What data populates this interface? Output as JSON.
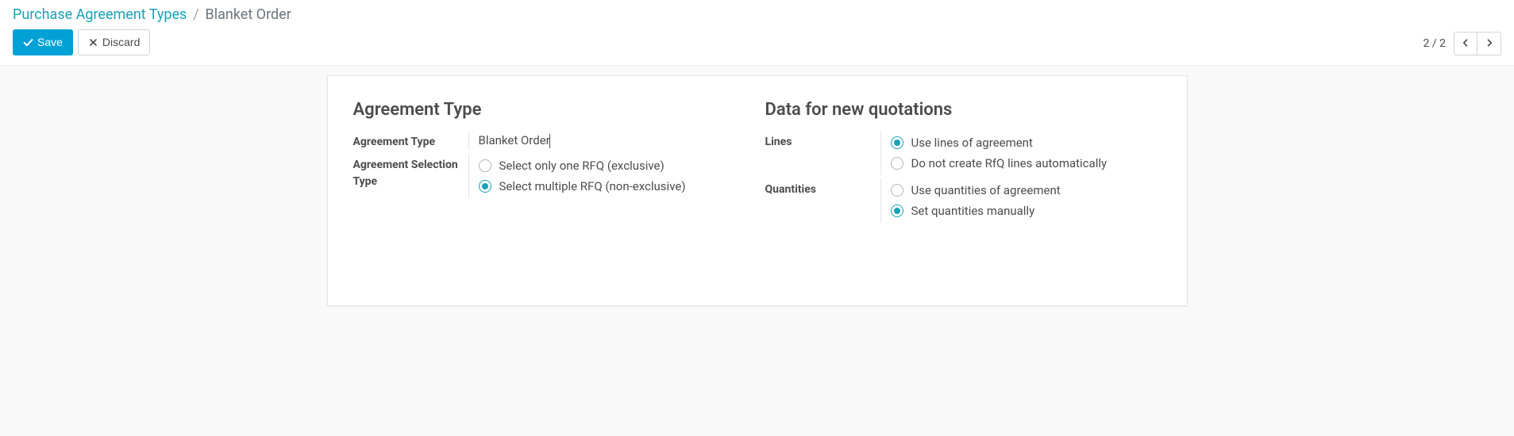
{
  "breadcrumb": {
    "parent": "Purchase Agreement Types",
    "current": "Blanket Order"
  },
  "buttons": {
    "save": "Save",
    "discard": "Discard"
  },
  "pager": {
    "text": "2 / 2"
  },
  "left_section": {
    "title": "Agreement Type",
    "fields": {
      "agreement_type": {
        "label": "Agreement Type",
        "value": "Blanket Order"
      },
      "selection_type": {
        "label": "Agreement Selection Type",
        "options": [
          {
            "label": "Select only one RFQ (exclusive)",
            "selected": false
          },
          {
            "label": "Select multiple RFQ (non-exclusive)",
            "selected": true
          }
        ]
      }
    }
  },
  "right_section": {
    "title": "Data for new quotations",
    "fields": {
      "lines": {
        "label": "Lines",
        "options": [
          {
            "label": "Use lines of agreement",
            "selected": true
          },
          {
            "label": "Do not create RfQ lines automatically",
            "selected": false
          }
        ]
      },
      "quantities": {
        "label": "Quantities",
        "options": [
          {
            "label": "Use quantities of agreement",
            "selected": false
          },
          {
            "label": "Set quantities manually",
            "selected": true
          }
        ]
      }
    }
  }
}
